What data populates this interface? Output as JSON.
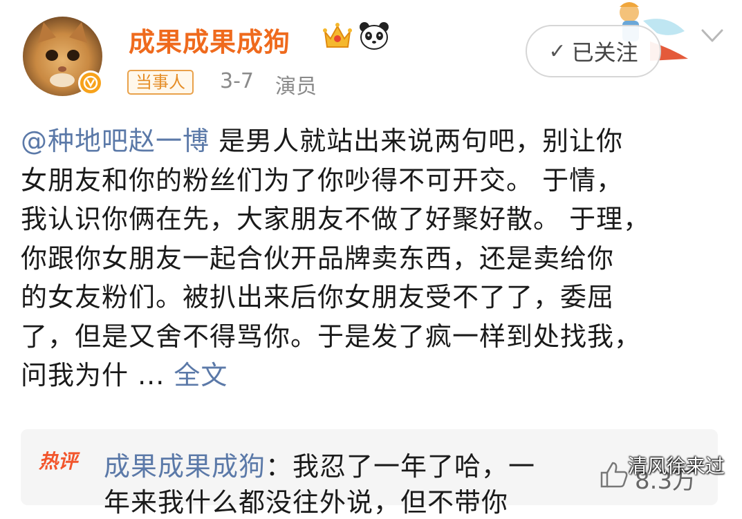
{
  "header": {
    "username": "成果成果成狗",
    "badge": "当事人",
    "date": "3-7",
    "role": "演员",
    "follow_label": "已关注",
    "follow_check": "✓"
  },
  "post": {
    "mention": "@种地吧赵一博",
    "lines": [
      " 是男人就站出来说两句吧，别让你",
      "女朋友和你的粉丝们为了你吵得不可开交。 于情，",
      "我认识你俩在先，大家朋友不做了好聚好散。 于理，",
      "你跟你女朋友一起合伙开品牌卖东西，还是卖给你",
      "的女友粉们。被扒出来后你女朋友受不了了，委屈",
      "了，但是又舍不得骂你。于是发了疯一样到处找我，"
    ],
    "last_line": "问我为什 ... ",
    "full_text_link": "全文"
  },
  "hot_comment": {
    "label": "热评",
    "user": "成果成果成狗",
    "text": "：我忍了一年了哈，一",
    "text_line2": "年来我什么都没往外说，但不带你",
    "like_count": "8.3万"
  },
  "watermark": "清风徐来过",
  "icons": [
    "verified-icon",
    "crown-icon",
    "panda-icon",
    "check-icon",
    "chevron-down-icon",
    "like-icon"
  ],
  "colors": {
    "username": "#ef6a1d",
    "link": "#5b79a8",
    "badge_border": "#e9a14a",
    "hot_label": "#f2552c"
  }
}
